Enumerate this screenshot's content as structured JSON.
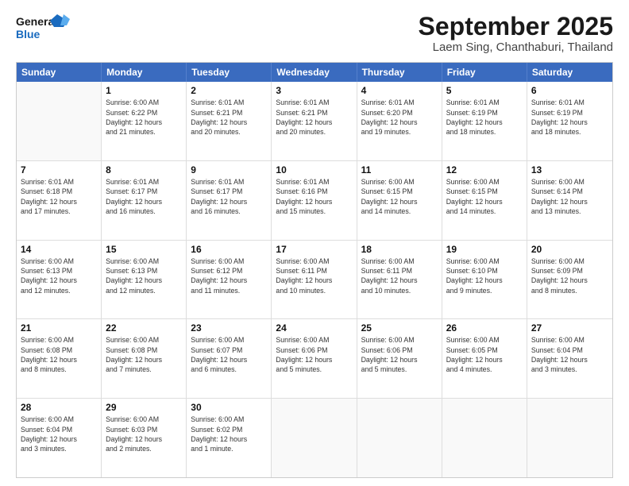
{
  "logo": {
    "line1": "General",
    "line2": "Blue"
  },
  "title": "September 2025",
  "subtitle": "Laem Sing, Chanthaburi, Thailand",
  "days_of_week": [
    "Sunday",
    "Monday",
    "Tuesday",
    "Wednesday",
    "Thursday",
    "Friday",
    "Saturday"
  ],
  "weeks": [
    [
      {
        "day": "",
        "info": ""
      },
      {
        "day": "1",
        "info": "Sunrise: 6:00 AM\nSunset: 6:22 PM\nDaylight: 12 hours\nand 21 minutes."
      },
      {
        "day": "2",
        "info": "Sunrise: 6:01 AM\nSunset: 6:21 PM\nDaylight: 12 hours\nand 20 minutes."
      },
      {
        "day": "3",
        "info": "Sunrise: 6:01 AM\nSunset: 6:21 PM\nDaylight: 12 hours\nand 20 minutes."
      },
      {
        "day": "4",
        "info": "Sunrise: 6:01 AM\nSunset: 6:20 PM\nDaylight: 12 hours\nand 19 minutes."
      },
      {
        "day": "5",
        "info": "Sunrise: 6:01 AM\nSunset: 6:19 PM\nDaylight: 12 hours\nand 18 minutes."
      },
      {
        "day": "6",
        "info": "Sunrise: 6:01 AM\nSunset: 6:19 PM\nDaylight: 12 hours\nand 18 minutes."
      }
    ],
    [
      {
        "day": "7",
        "info": "Sunrise: 6:01 AM\nSunset: 6:18 PM\nDaylight: 12 hours\nand 17 minutes."
      },
      {
        "day": "8",
        "info": "Sunrise: 6:01 AM\nSunset: 6:17 PM\nDaylight: 12 hours\nand 16 minutes."
      },
      {
        "day": "9",
        "info": "Sunrise: 6:01 AM\nSunset: 6:17 PM\nDaylight: 12 hours\nand 16 minutes."
      },
      {
        "day": "10",
        "info": "Sunrise: 6:01 AM\nSunset: 6:16 PM\nDaylight: 12 hours\nand 15 minutes."
      },
      {
        "day": "11",
        "info": "Sunrise: 6:00 AM\nSunset: 6:15 PM\nDaylight: 12 hours\nand 14 minutes."
      },
      {
        "day": "12",
        "info": "Sunrise: 6:00 AM\nSunset: 6:15 PM\nDaylight: 12 hours\nand 14 minutes."
      },
      {
        "day": "13",
        "info": "Sunrise: 6:00 AM\nSunset: 6:14 PM\nDaylight: 12 hours\nand 13 minutes."
      }
    ],
    [
      {
        "day": "14",
        "info": "Sunrise: 6:00 AM\nSunset: 6:13 PM\nDaylight: 12 hours\nand 12 minutes."
      },
      {
        "day": "15",
        "info": "Sunrise: 6:00 AM\nSunset: 6:13 PM\nDaylight: 12 hours\nand 12 minutes."
      },
      {
        "day": "16",
        "info": "Sunrise: 6:00 AM\nSunset: 6:12 PM\nDaylight: 12 hours\nand 11 minutes."
      },
      {
        "day": "17",
        "info": "Sunrise: 6:00 AM\nSunset: 6:11 PM\nDaylight: 12 hours\nand 10 minutes."
      },
      {
        "day": "18",
        "info": "Sunrise: 6:00 AM\nSunset: 6:11 PM\nDaylight: 12 hours\nand 10 minutes."
      },
      {
        "day": "19",
        "info": "Sunrise: 6:00 AM\nSunset: 6:10 PM\nDaylight: 12 hours\nand 9 minutes."
      },
      {
        "day": "20",
        "info": "Sunrise: 6:00 AM\nSunset: 6:09 PM\nDaylight: 12 hours\nand 8 minutes."
      }
    ],
    [
      {
        "day": "21",
        "info": "Sunrise: 6:00 AM\nSunset: 6:08 PM\nDaylight: 12 hours\nand 8 minutes."
      },
      {
        "day": "22",
        "info": "Sunrise: 6:00 AM\nSunset: 6:08 PM\nDaylight: 12 hours\nand 7 minutes."
      },
      {
        "day": "23",
        "info": "Sunrise: 6:00 AM\nSunset: 6:07 PM\nDaylight: 12 hours\nand 6 minutes."
      },
      {
        "day": "24",
        "info": "Sunrise: 6:00 AM\nSunset: 6:06 PM\nDaylight: 12 hours\nand 5 minutes."
      },
      {
        "day": "25",
        "info": "Sunrise: 6:00 AM\nSunset: 6:06 PM\nDaylight: 12 hours\nand 5 minutes."
      },
      {
        "day": "26",
        "info": "Sunrise: 6:00 AM\nSunset: 6:05 PM\nDaylight: 12 hours\nand 4 minutes."
      },
      {
        "day": "27",
        "info": "Sunrise: 6:00 AM\nSunset: 6:04 PM\nDaylight: 12 hours\nand 3 minutes."
      }
    ],
    [
      {
        "day": "28",
        "info": "Sunrise: 6:00 AM\nSunset: 6:04 PM\nDaylight: 12 hours\nand 3 minutes."
      },
      {
        "day": "29",
        "info": "Sunrise: 6:00 AM\nSunset: 6:03 PM\nDaylight: 12 hours\nand 2 minutes."
      },
      {
        "day": "30",
        "info": "Sunrise: 6:00 AM\nSunset: 6:02 PM\nDaylight: 12 hours\nand 1 minute."
      },
      {
        "day": "",
        "info": ""
      },
      {
        "day": "",
        "info": ""
      },
      {
        "day": "",
        "info": ""
      },
      {
        "day": "",
        "info": ""
      }
    ]
  ]
}
